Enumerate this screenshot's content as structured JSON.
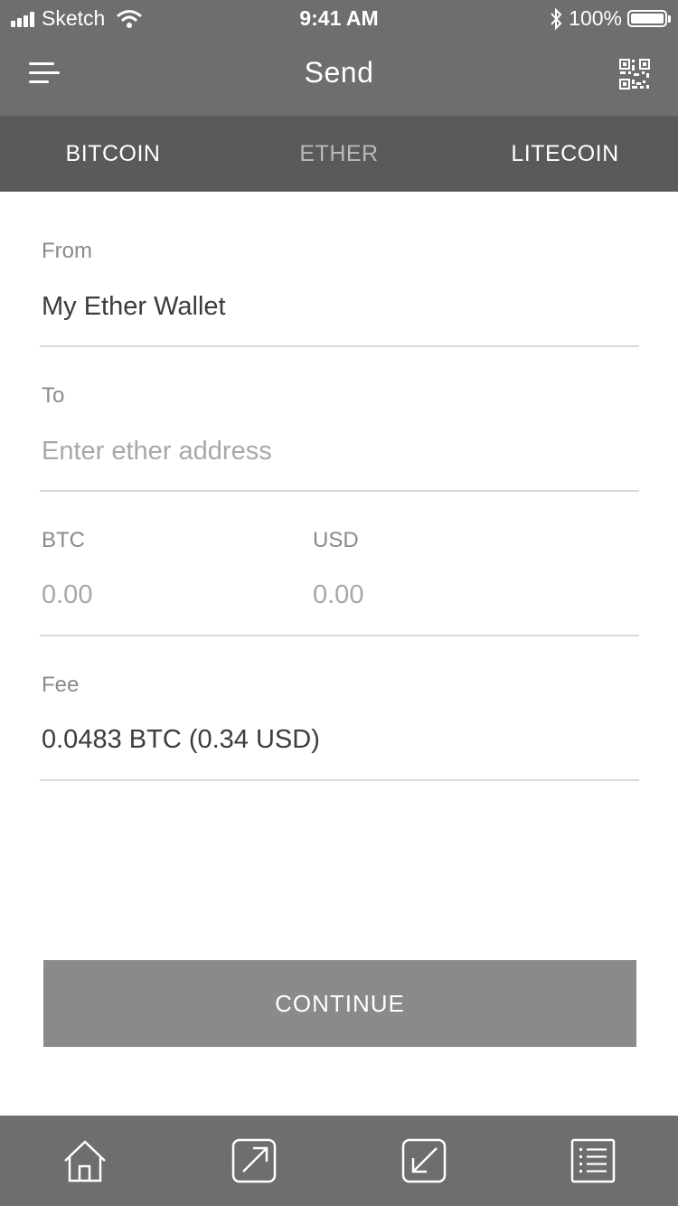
{
  "status_bar": {
    "carrier": "Sketch",
    "time": "9:41 AM",
    "battery": "100%"
  },
  "nav": {
    "title": "Send",
    "left_icon": "menu-icon",
    "right_icon": "qr-code-icon"
  },
  "tabs": [
    {
      "label": "BITCOIN",
      "active": true
    },
    {
      "label": "ETHER",
      "active": false
    },
    {
      "label": "LITECOIN",
      "active": true
    }
  ],
  "form": {
    "from_label": "From",
    "from_value": "My Ether Wallet",
    "to_label": "To",
    "to_placeholder": "Enter ether address",
    "btc_label": "BTC",
    "btc_placeholder": "0.00",
    "usd_label": "USD",
    "usd_placeholder": "0.00",
    "fee_label": "Fee",
    "fee_value": "0.0483 BTC (0.34 USD)"
  },
  "continue_label": "CONTINUE",
  "bottom_tabs": [
    "home-icon",
    "send-icon",
    "receive-icon",
    "transactions-list-icon"
  ],
  "colors": {
    "header": "#6e6e6e",
    "tabs_bg": "#5a5a5a",
    "button": "#8a8a8a"
  }
}
